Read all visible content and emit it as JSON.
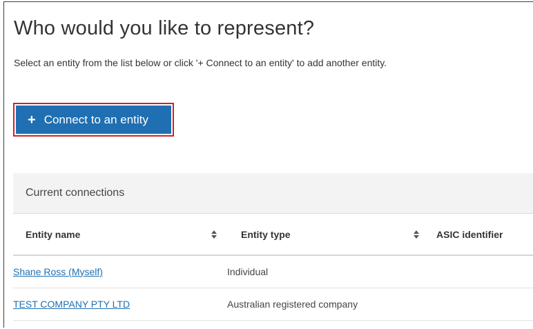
{
  "page": {
    "title": "Who would you like to represent?",
    "instructions": "Select an entity from the list below or click '+ Connect to an entity' to add another entity."
  },
  "connect_button": {
    "icon": "plus-icon",
    "icon_glyph": "+",
    "label": "Connect to an entity",
    "color": "#1f6fb2",
    "highlight_color": "#d0202d"
  },
  "connections": {
    "heading": "Current connections",
    "columns": [
      {
        "label": "Entity name",
        "sortable": true
      },
      {
        "label": "Entity type",
        "sortable": true
      },
      {
        "label": "ASIC identifier",
        "sortable": false
      }
    ],
    "rows": [
      {
        "name": "Shane Ross (Myself)",
        "type": "Individual",
        "asic": ""
      },
      {
        "name": "TEST COMPANY PTY LTD",
        "type": "Australian registered company",
        "asic": ""
      }
    ]
  }
}
